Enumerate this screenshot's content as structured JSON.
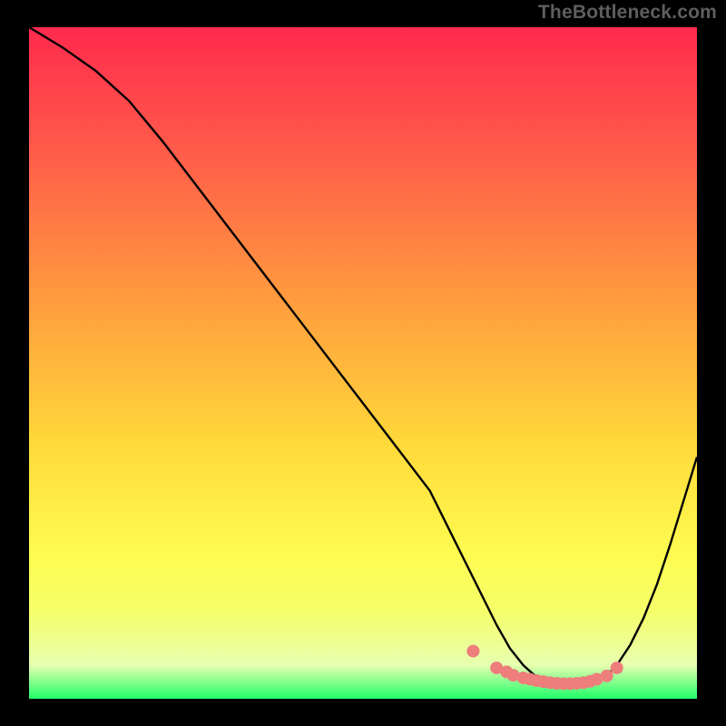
{
  "watermark": "TheBottleneck.com",
  "chart_data": {
    "type": "line",
    "title": "",
    "xlabel": "",
    "ylabel": "",
    "xlim": [
      0,
      100
    ],
    "ylim": [
      0,
      100
    ],
    "grid": false,
    "background_gradient": [
      "#ff2a4d",
      "#ff5a4a",
      "#ff9a3e",
      "#ffd93a",
      "#fffb50",
      "#f5ff6a",
      "#e7ffb0",
      "#1fff6a"
    ],
    "series": [
      {
        "name": "bottleneck-curve",
        "color": "#000000",
        "x": [
          0,
          5,
          10,
          15,
          20,
          25,
          30,
          35,
          40,
          45,
          50,
          55,
          60,
          62,
          64,
          66,
          68,
          70,
          72,
          74,
          76,
          78,
          80,
          82,
          84,
          86,
          88,
          90,
          92,
          94,
          96,
          98,
          100
        ],
        "y": [
          100,
          97,
          93.5,
          89,
          83,
          76.5,
          70,
          63.5,
          57,
          50.5,
          44,
          37.5,
          31,
          27,
          23,
          19,
          15,
          11,
          7.5,
          5,
          3.2,
          2.3,
          2,
          2,
          2.2,
          3,
          5,
          8,
          12,
          17,
          23,
          29.5,
          36
        ]
      }
    ],
    "markers": {
      "name": "highlight-dots",
      "color": "#ed7e7c",
      "radius_px": 7,
      "x": [
        66.5,
        70,
        71.5,
        72.5,
        74,
        75,
        76,
        77,
        78,
        79,
        80,
        81,
        82,
        83,
        84,
        85,
        86.5,
        88
      ],
      "y": [
        7.1,
        4.6,
        4.0,
        3.5,
        3.1,
        2.9,
        2.7,
        2.55,
        2.4,
        2.3,
        2.25,
        2.25,
        2.3,
        2.4,
        2.6,
        2.9,
        3.4,
        4.6
      ]
    }
  }
}
